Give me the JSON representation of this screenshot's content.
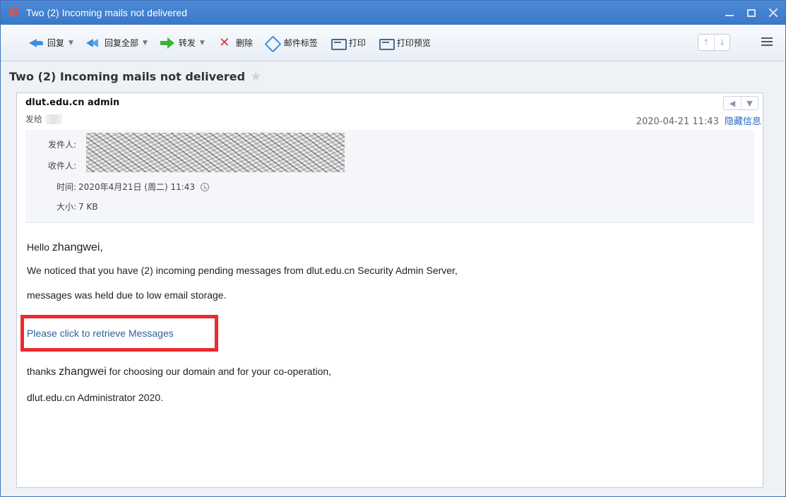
{
  "window": {
    "title": "Two (2) Incoming mails not delivered"
  },
  "toolbar": {
    "reply": "回复",
    "reply_all": "回复全部",
    "forward": "转发",
    "delete": "删除",
    "tag": "邮件标签",
    "print": "打印",
    "print_preview": "打印预览"
  },
  "mail": {
    "subject": "Two (2) Incoming mails not delivered",
    "sender_name": "dlut.edu.cn admin",
    "to_label": "发给",
    "date": "2020-04-21 11:43",
    "hide_info": "隐藏信息",
    "details": {
      "from_label": "发件人:",
      "to_label": "收件人:",
      "time_label": "时间:",
      "time_value": "2020年4月21日 (周二) 11:43",
      "size_label": "大小:",
      "size_value": "7 KB"
    },
    "body": {
      "greeting_prefix": "Hello ",
      "greeting_name": "zhangwei,",
      "line1": "We noticed that you have (2) incoming pending messages from dlut.edu.cn Security Admin Server,",
      "line2": "messages was held due to low email storage.",
      "link": "Please click to retrieve Messages",
      "thanks_prefix": "thanks ",
      "thanks_name": "zhangwei",
      "thanks_suffix": " for choosing our domain and for your co-operation,",
      "signature": "dlut.edu.cn Administrator 2020."
    }
  },
  "colors": {
    "titlebar": "#3a78c7",
    "link": "#2f5f9c",
    "highlight_box": "#ed2a2f"
  }
}
